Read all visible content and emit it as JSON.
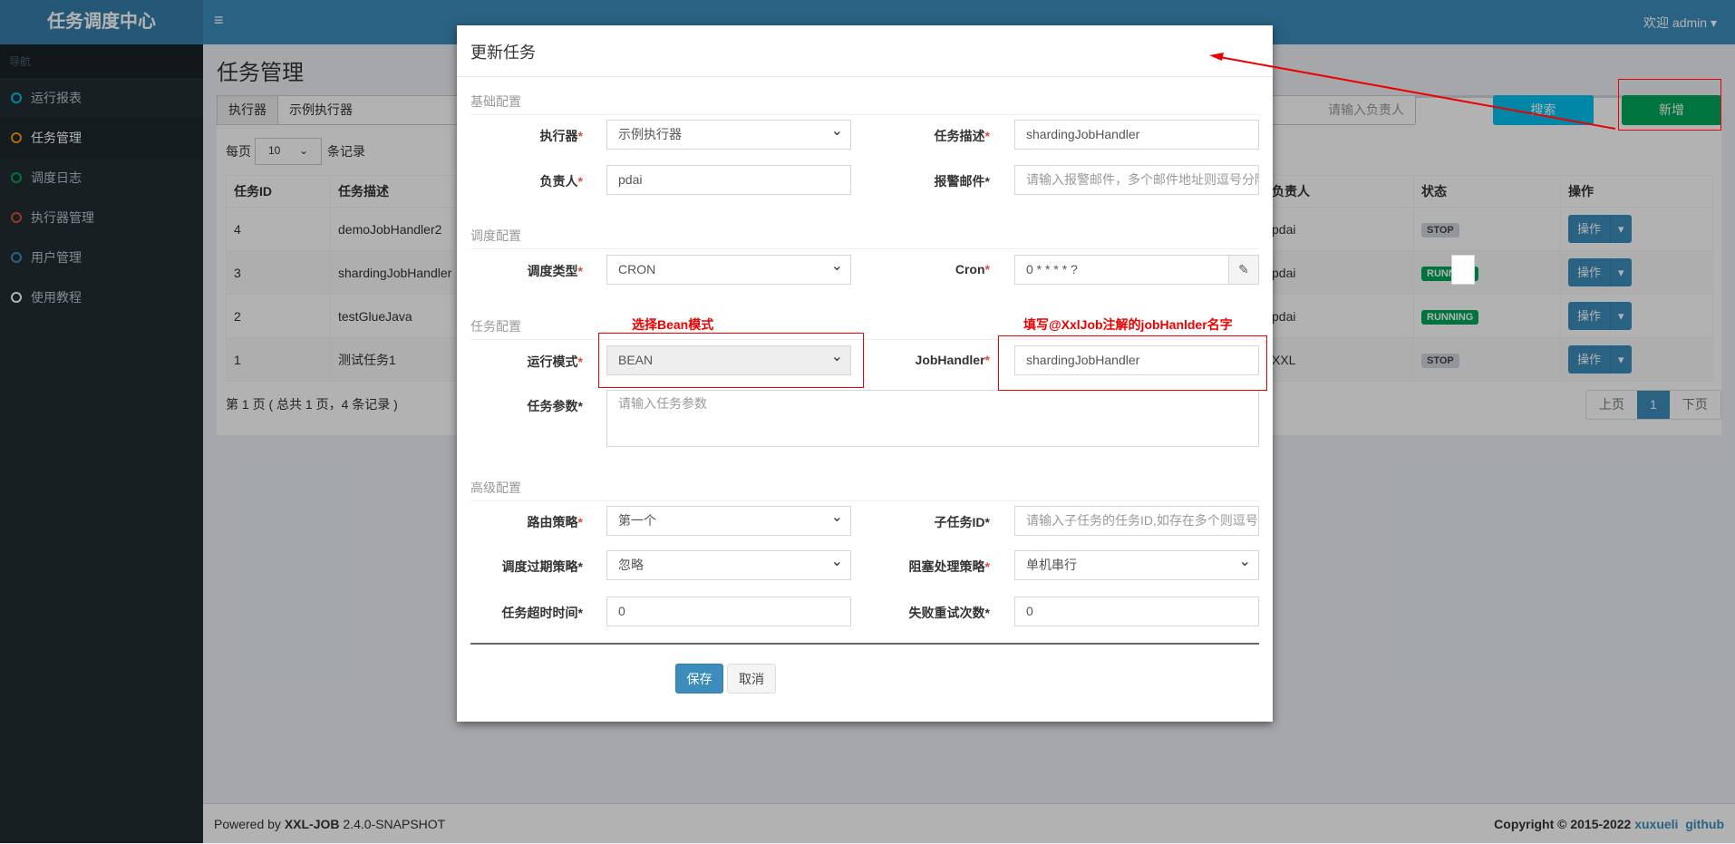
{
  "app": {
    "title": "任务调度中心",
    "menu_icon": "≡",
    "user": "欢迎 admin"
  },
  "sidebar": {
    "header": "导航",
    "items": [
      {
        "label": "运行报表",
        "color": "#00c0ef"
      },
      {
        "label": "任务管理",
        "color": "#f39c12"
      },
      {
        "label": "调度日志",
        "color": "#00a65a"
      },
      {
        "label": "执行器管理",
        "color": "#dd4b39"
      },
      {
        "label": "用户管理",
        "color": "#3c8dbc"
      },
      {
        "label": "使用教程",
        "color": "#ffffff"
      }
    ]
  },
  "page": {
    "title": "任务管理",
    "executor_label": "执行器",
    "executor_value": "示例执行器",
    "owner_placeholder": "请输入负责人",
    "search": "搜索",
    "add": "新增",
    "per_page_label": "每页",
    "per_page": "10",
    "records_label": "条记录",
    "columns": {
      "id": "任务ID",
      "desc": "任务描述",
      "owner": "负责人",
      "status": "状态",
      "ops": "操作"
    },
    "rows": [
      {
        "id": "4",
        "desc": "demoJobHandler2",
        "owner": "pdai",
        "status": "STOP",
        "op": "操作"
      },
      {
        "id": "3",
        "desc": "shardingJobHandler",
        "owner": "pdai",
        "status": "RUNNING",
        "op": "操作"
      },
      {
        "id": "2",
        "desc": "testGlueJava",
        "owner": "pdai",
        "status": "RUNNING",
        "op": "操作"
      },
      {
        "id": "1",
        "desc": "测试任务1",
        "owner": "XXL",
        "status": "STOP",
        "op": "操作"
      }
    ],
    "summary": "第 1 页 ( 总共 1 页，4 条记录 )",
    "pager": {
      "prev": "上页",
      "current": "1",
      "next": "下页"
    }
  },
  "footer": {
    "powered": "Powered by ",
    "brand": "XXL-JOB",
    "version": " 2.4.0-SNAPSHOT",
    "copyright": "Copyright © 2015-2022 ",
    "link1": "xuxueli",
    "link2": "github"
  },
  "modal": {
    "title": "更新任务",
    "sections": {
      "basic": "基础配置",
      "schedule": "调度配置",
      "task": "任务配置",
      "advanced": "高级配置"
    },
    "fields": {
      "executor": {
        "label": "执行器",
        "value": "示例执行器"
      },
      "desc": {
        "label": "任务描述",
        "value": "shardingJobHandler"
      },
      "owner": {
        "label": "负责人",
        "value": "pdai"
      },
      "alarm": {
        "label": "报警邮件",
        "placeholder": "请输入报警邮件，多个邮件地址则逗号分隔"
      },
      "schedule_type": {
        "label": "调度类型",
        "value": "CRON"
      },
      "cron": {
        "label": "Cron",
        "value": "0 * * * * ?"
      },
      "glue_type": {
        "label": "运行模式",
        "value": "BEAN"
      },
      "handler": {
        "label": "JobHandler",
        "value": "shardingJobHandler"
      },
      "params": {
        "label": "任务参数",
        "placeholder": "请输入任务参数"
      },
      "route": {
        "label": "路由策略",
        "value": "第一个"
      },
      "child": {
        "label": "子任务ID",
        "placeholder": "请输入子任务的任务ID,如存在多个则逗号分隔"
      },
      "misfire": {
        "label": "调度过期策略",
        "value": "忽略"
      },
      "block": {
        "label": "阻塞处理策略",
        "value": "单机串行"
      },
      "timeout": {
        "label": "任务超时时间",
        "value": "0"
      },
      "retry": {
        "label": "失败重试次数",
        "value": "0"
      }
    },
    "save": "保存",
    "cancel": "取消"
  },
  "annotations": {
    "bean": "选择Bean模式",
    "handler": "填写@XxlJob注解的jobHanlder名字"
  }
}
